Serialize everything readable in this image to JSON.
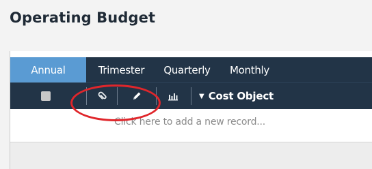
{
  "page": {
    "title": "Operating Budget"
  },
  "tabs": [
    {
      "label": "Annual",
      "active": true
    },
    {
      "label": "Trimester",
      "active": false
    },
    {
      "label": "Quarterly",
      "active": false
    },
    {
      "label": "Monthly",
      "active": false
    }
  ],
  "toolbar": {
    "select_all": {
      "checked": false
    },
    "attach_icon": "paperclip-icon",
    "edit_icon": "pencil-icon",
    "chart_icon": "bar-chart-icon",
    "column_header": {
      "label": "Cost Object",
      "sort_icon": "caret-down-icon"
    }
  },
  "grid": {
    "new_record_prompt": "Click here to add a new record..."
  },
  "colors": {
    "header_bg": "#223447",
    "active_tab": "#5a9bd3",
    "highlight": "#e0262b"
  }
}
